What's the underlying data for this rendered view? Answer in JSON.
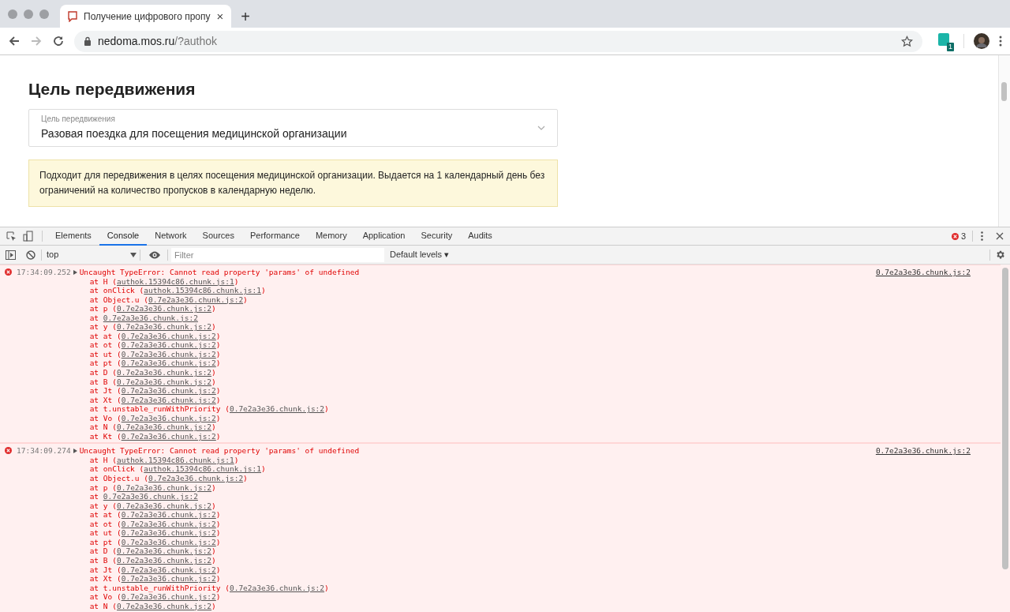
{
  "browser": {
    "tab": {
      "title": "Получение цифрового пропу",
      "close": "×"
    },
    "new_tab": "+",
    "url": {
      "host": "nedoma.mos.ru",
      "path": "/?authok"
    },
    "extension_badge": "1"
  },
  "page": {
    "heading": "Цель передвижения",
    "select": {
      "label": "Цель передвижения",
      "value": "Разовая поездка для посещения медицинской организации"
    },
    "notice": "Подходит для передвижения в целях посещения медицинской организации. Выдается на 1 календарный день без ограничений на количество пропусков в календарную неделю."
  },
  "devtools": {
    "tabs": [
      {
        "label": "Elements",
        "selected": false
      },
      {
        "label": "Console",
        "selected": true
      },
      {
        "label": "Network",
        "selected": false
      },
      {
        "label": "Sources",
        "selected": false
      },
      {
        "label": "Performance",
        "selected": false
      },
      {
        "label": "Memory",
        "selected": false
      },
      {
        "label": "Application",
        "selected": false
      },
      {
        "label": "Security",
        "selected": false
      },
      {
        "label": "Audits",
        "selected": false
      }
    ],
    "error_count": "3",
    "context": "top",
    "filter": {
      "placeholder": "Filter"
    },
    "levels": "Default levels ▾",
    "messages": [
      {
        "time": "17:34:09.252",
        "text": "Uncaught TypeError: Cannot read property 'params' of undefined",
        "source": "0.7e2a3e36.chunk.js:2",
        "frames": [
          {
            "call": "at H (",
            "link": "authok.15394c86.chunk.js:1",
            "tail": ")"
          },
          {
            "call": "at onClick (",
            "link": "authok.15394c86.chunk.js:1",
            "tail": ")"
          },
          {
            "call": "at Object.u (",
            "link": "0.7e2a3e36.chunk.js:2",
            "tail": ")"
          },
          {
            "call": "at p (",
            "link": "0.7e2a3e36.chunk.js:2",
            "tail": ")"
          },
          {
            "call": "at",
            "link": "0.7e2a3e36.chunk.js:2"
          },
          {
            "call": "at y (",
            "link": "0.7e2a3e36.chunk.js:2",
            "tail": ")"
          },
          {
            "call": "at at (",
            "link": "0.7e2a3e36.chunk.js:2",
            "tail": ")"
          },
          {
            "call": "at ot (",
            "link": "0.7e2a3e36.chunk.js:2",
            "tail": ")"
          },
          {
            "call": "at ut (",
            "link": "0.7e2a3e36.chunk.js:2",
            "tail": ")"
          },
          {
            "call": "at pt (",
            "link": "0.7e2a3e36.chunk.js:2",
            "tail": ")"
          },
          {
            "call": "at D (",
            "link": "0.7e2a3e36.chunk.js:2",
            "tail": ")"
          },
          {
            "call": "at B (",
            "link": "0.7e2a3e36.chunk.js:2",
            "tail": ")"
          },
          {
            "call": "at Jt (",
            "link": "0.7e2a3e36.chunk.js:2",
            "tail": ")"
          },
          {
            "call": "at Xt (",
            "link": "0.7e2a3e36.chunk.js:2",
            "tail": ")"
          },
          {
            "call": "at t.unstable_runWithPriority (",
            "link": "0.7e2a3e36.chunk.js:2",
            "tail": ")"
          },
          {
            "call": "at Vo (",
            "link": "0.7e2a3e36.chunk.js:2",
            "tail": ")"
          },
          {
            "call": "at N (",
            "link": "0.7e2a3e36.chunk.js:2",
            "tail": ")"
          },
          {
            "call": "at Kt (",
            "link": "0.7e2a3e36.chunk.js:2",
            "tail": ")"
          }
        ]
      },
      {
        "time": "17:34:09.274",
        "text": "Uncaught TypeError: Cannot read property 'params' of undefined",
        "source": "0.7e2a3e36.chunk.js:2",
        "frames": [
          {
            "call": "at H (",
            "link": "authok.15394c86.chunk.js:1",
            "tail": ")"
          },
          {
            "call": "at onClick (",
            "link": "authok.15394c86.chunk.js:1",
            "tail": ")"
          },
          {
            "call": "at Object.u (",
            "link": "0.7e2a3e36.chunk.js:2",
            "tail": ")"
          },
          {
            "call": "at p (",
            "link": "0.7e2a3e36.chunk.js:2",
            "tail": ")"
          },
          {
            "call": "at",
            "link": "0.7e2a3e36.chunk.js:2"
          },
          {
            "call": "at y (",
            "link": "0.7e2a3e36.chunk.js:2",
            "tail": ")"
          },
          {
            "call": "at at (",
            "link": "0.7e2a3e36.chunk.js:2",
            "tail": ")"
          },
          {
            "call": "at ot (",
            "link": "0.7e2a3e36.chunk.js:2",
            "tail": ")"
          },
          {
            "call": "at ut (",
            "link": "0.7e2a3e36.chunk.js:2",
            "tail": ")"
          },
          {
            "call": "at pt (",
            "link": "0.7e2a3e36.chunk.js:2",
            "tail": ")"
          },
          {
            "call": "at D (",
            "link": "0.7e2a3e36.chunk.js:2",
            "tail": ")"
          },
          {
            "call": "at B (",
            "link": "0.7e2a3e36.chunk.js:2",
            "tail": ")"
          },
          {
            "call": "at Jt (",
            "link": "0.7e2a3e36.chunk.js:2",
            "tail": ")"
          },
          {
            "call": "at Xt (",
            "link": "0.7e2a3e36.chunk.js:2",
            "tail": ")"
          },
          {
            "call": "at t.unstable_runWithPriority (",
            "link": "0.7e2a3e36.chunk.js:2",
            "tail": ")"
          },
          {
            "call": "at Vo (",
            "link": "0.7e2a3e36.chunk.js:2",
            "tail": ")"
          },
          {
            "call": "at N (",
            "link": "0.7e2a3e36.chunk.js:2",
            "tail": ")"
          }
        ]
      }
    ]
  }
}
